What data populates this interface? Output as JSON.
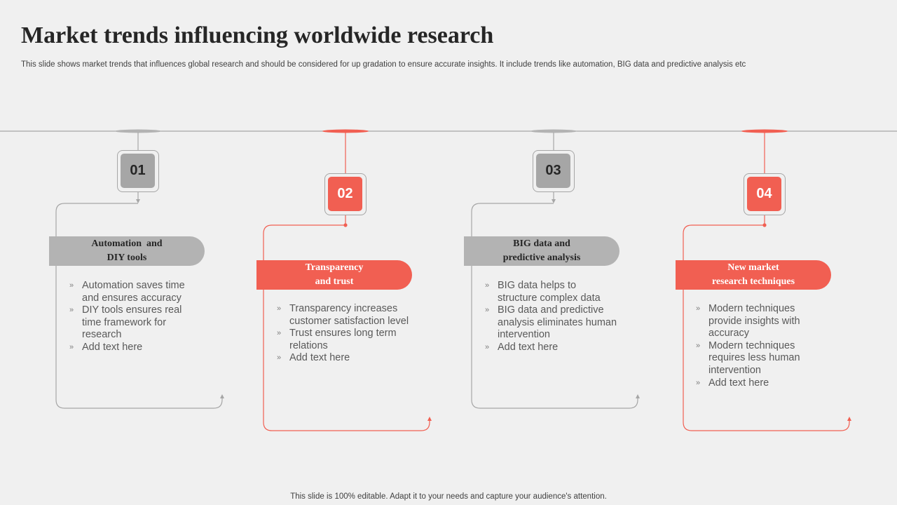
{
  "header": {
    "title": "Market trends influencing worldwide research",
    "subtitle": "This slide shows market trends that influences global research and should be considered for up gradation to ensure accurate insights. It include trends like automation, BIG data and predictive analysis etc"
  },
  "colors": {
    "accent": "#f15f52",
    "neutral": "#a6a6a6",
    "background": "#f0f0f0",
    "text": "#595959"
  },
  "steps": [
    {
      "number": "01",
      "title_line1": "Automation  and",
      "title_line2": "DIY tools",
      "style": "gray",
      "bullets": [
        "Automation saves time and ensures accuracy",
        "DIY tools ensures real time framework for research",
        "Add text here"
      ]
    },
    {
      "number": "02",
      "title_line1": "Transparency",
      "title_line2": "and trust",
      "style": "red",
      "bullets": [
        "Transparency increases customer satisfaction level",
        "Trust ensures long term relations",
        "Add text here"
      ]
    },
    {
      "number": "03",
      "title_line1": "BIG data and",
      "title_line2": "predictive analysis",
      "style": "gray",
      "bullets": [
        "BIG data helps to structure complex data",
        "BIG data and predictive analysis eliminates human intervention",
        "Add text here"
      ]
    },
    {
      "number": "04",
      "title_line1": "New market",
      "title_line2": "research techniques",
      "style": "red",
      "bullets": [
        "Modern techniques provide insights with accuracy",
        "Modern techniques requires less human intervention",
        "Add text here"
      ]
    }
  ],
  "bullet_marker": "»",
  "footer": "This slide is 100% editable. Adapt it to your needs and capture your audience's attention."
}
